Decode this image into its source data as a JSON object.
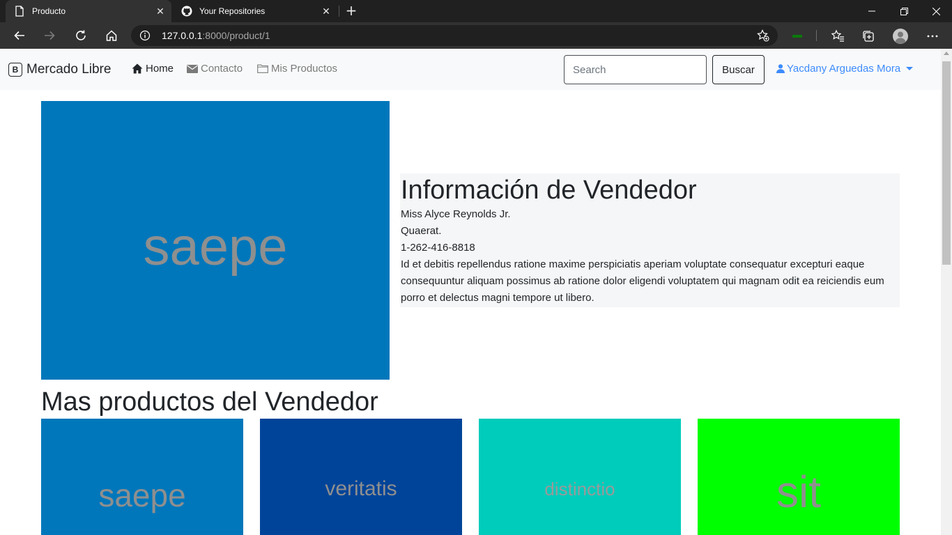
{
  "browser": {
    "tabs": [
      {
        "title": "Producto",
        "icon": "page-icon",
        "active": true
      },
      {
        "title": "Your Repositories",
        "icon": "github-icon",
        "active": false
      }
    ],
    "address": {
      "host": "127.0.0.1",
      "path": ":8000/product/1"
    }
  },
  "navbar": {
    "brand": "Mercado Libre",
    "links": [
      {
        "label": "Home",
        "icon": "home-icon"
      },
      {
        "label": "Contacto",
        "icon": "envelope-icon"
      },
      {
        "label": "Mis Productos",
        "icon": "folder-icon"
      }
    ],
    "search_placeholder": "Search",
    "search_button": "Buscar",
    "user_name": "Yacdany Arguedas Mora"
  },
  "product": {
    "image_text": "saepe",
    "image_color": "#0077bb"
  },
  "seller": {
    "heading": "Información de Vendedor",
    "name": "Miss Alyce Reynolds Jr.",
    "line2": "Quaerat.",
    "phone": "1-262-416-8818",
    "description": "Id et debitis repellendus ratione maxime perspiciatis aperiam voluptate consequatur excepturi eaque consequuntur aliquam possimus ab ratione dolor eligendi voluptatem qui magnam odit ea reiciendis eum porro et delectus magni tempore ut libero."
  },
  "more_products": {
    "heading": "Mas productos del Vendedor",
    "items": [
      {
        "text": "saepe",
        "color": "#0077bb"
      },
      {
        "text": "veritatis",
        "color": "#004499"
      },
      {
        "text": "distinctio",
        "color": "#00ccbb"
      },
      {
        "text": "sit",
        "color": "#00ff00"
      }
    ]
  }
}
